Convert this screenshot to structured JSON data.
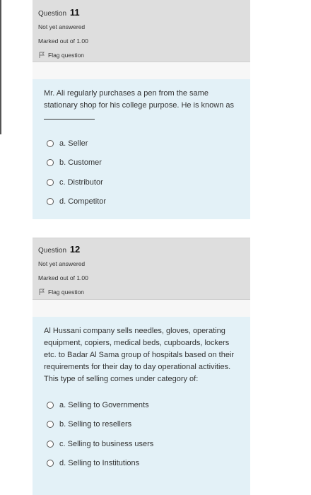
{
  "questions": [
    {
      "label": "Question",
      "number": "11",
      "status": "Not yet answered",
      "marked": "Marked out of 1.00",
      "flag_label": "Flag question",
      "text": "Mr. Ali regularly purchases a pen from the same stationary shop for his college purpose. He is known as",
      "options": [
        "a. Seller",
        "b. Customer",
        "c. Distributor",
        "d. Competitor"
      ]
    },
    {
      "label": "Question",
      "number": "12",
      "status": "Not yet answered",
      "marked": "Marked out of 1.00",
      "flag_label": "Flag question",
      "text": "Al Hussani company sells needles, gloves, operating equipment, copiers, medical beds, cupboards, lockers etc. to Badar Al Sama group of hospitals based on their requirements for their day to day operational activities. This type of selling comes under category of:",
      "options": [
        "a. Selling to Governments",
        "b. Selling to resellers",
        "c. Selling to business users",
        "d. Selling to Institutions"
      ]
    }
  ],
  "colors": {
    "info_bg": "#dedede",
    "content_bg": "#e3f1f7"
  }
}
